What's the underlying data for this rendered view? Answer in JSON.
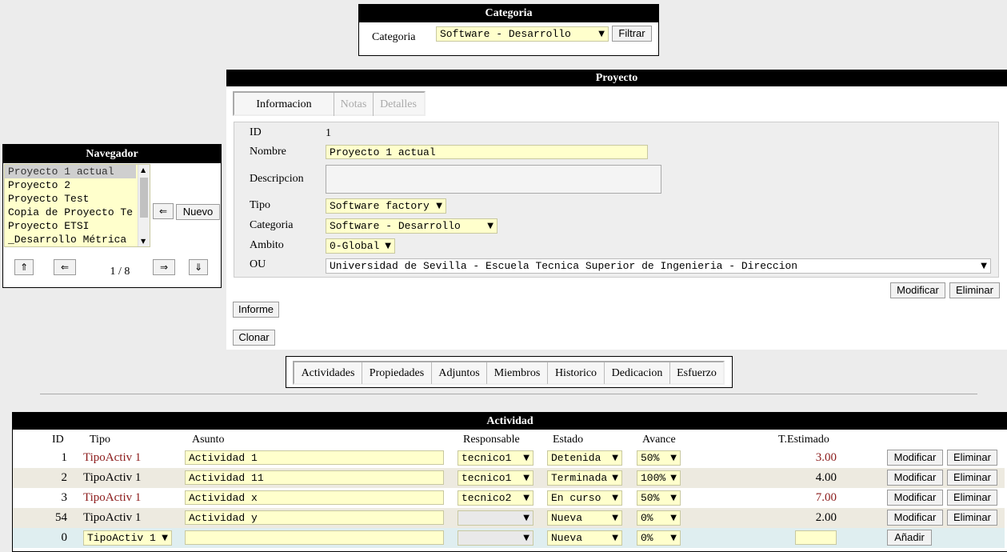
{
  "categoria_panel": {
    "title": "Categoria",
    "label": "Categoria",
    "selected": "Software - Desarrollo",
    "filter_button": "Filtrar"
  },
  "navegador": {
    "title": "Navegador",
    "items": [
      "Proyecto 1 actual",
      "Proyecto 2",
      "Proyecto Test",
      "Copia de Proyecto Te",
      "Proyecto ETSI",
      "_Desarrollo Métrica"
    ],
    "back_symbol": "⇐",
    "new_button": "Nuevo",
    "first_symbol": "⇑",
    "prev_symbol": "⇐",
    "page_indicator": "1 / 8",
    "next_symbol": "⇒",
    "last_symbol": "⇓"
  },
  "proyecto": {
    "title": "Proyecto",
    "tabs": [
      "Informacion",
      "Notas",
      "Detalles"
    ],
    "fields": {
      "id_label": "ID",
      "id_value": "1",
      "nombre_label": "Nombre",
      "nombre_value": "Proyecto 1 actual",
      "descripcion_label": "Descripcion",
      "descripcion_value": "",
      "tipo_label": "Tipo",
      "tipo_value": "Software factory",
      "categoria_label": "Categoria",
      "categoria_value": "Software - Desarrollo",
      "ambito_label": "Ambito",
      "ambito_value": "0-Global",
      "ou_label": "OU",
      "ou_value": "Universidad de Sevilla - Escuela Tecnica Superior de Ingenieria - Direccion"
    },
    "modify_button": "Modificar",
    "delete_button": "Eliminar",
    "report_button": "Informe",
    "clone_button": "Clonar"
  },
  "section_tabs": [
    "Actividades",
    "Propiedades",
    "Adjuntos",
    "Miembros",
    "Historico",
    "Dedicacion",
    "Esfuerzo"
  ],
  "actividad": {
    "title": "Actividad",
    "headers": {
      "id": "ID",
      "tipo": "Tipo",
      "asunto": "Asunto",
      "responsable": "Responsable",
      "estado": "Estado",
      "avance": "Avance",
      "estimado": "T.Estimado"
    },
    "rows": [
      {
        "id": "1",
        "tipo": "TipoActiv 1",
        "asunto": "Actividad 1",
        "responsable": "tecnico1",
        "estado": "Detenida",
        "avance": "50%",
        "estimado": "3.00",
        "highlight": true
      },
      {
        "id": "2",
        "tipo": "TipoActiv 1",
        "asunto": "Actividad 11",
        "responsable": "tecnico1",
        "estado": "Terminada",
        "avance": "100%",
        "estimado": "4.00",
        "highlight": false
      },
      {
        "id": "3",
        "tipo": "TipoActiv 1",
        "asunto": "Actividad x",
        "responsable": "tecnico2",
        "estado": "En curso",
        "avance": "50%",
        "estimado": "7.00",
        "highlight": true
      },
      {
        "id": "54",
        "tipo": "TipoActiv 1",
        "asunto": "Actividad y",
        "responsable": "",
        "estado": "Nueva",
        "avance": "0%",
        "estimado": "2.00",
        "highlight": false
      }
    ],
    "new_row": {
      "id": "0",
      "tipo": "TipoActiv 1",
      "asunto": "",
      "responsable": "",
      "estado": "Nueva",
      "avance": "0%",
      "estimado": ""
    },
    "modify_button": "Modificar",
    "delete_button": "Eliminar",
    "add_button": "Añadir"
  },
  "colors": {
    "highlight_text": "#8b1a1a",
    "field_bg": "#ffffcc",
    "new_row_bg": "#dfeef0"
  }
}
